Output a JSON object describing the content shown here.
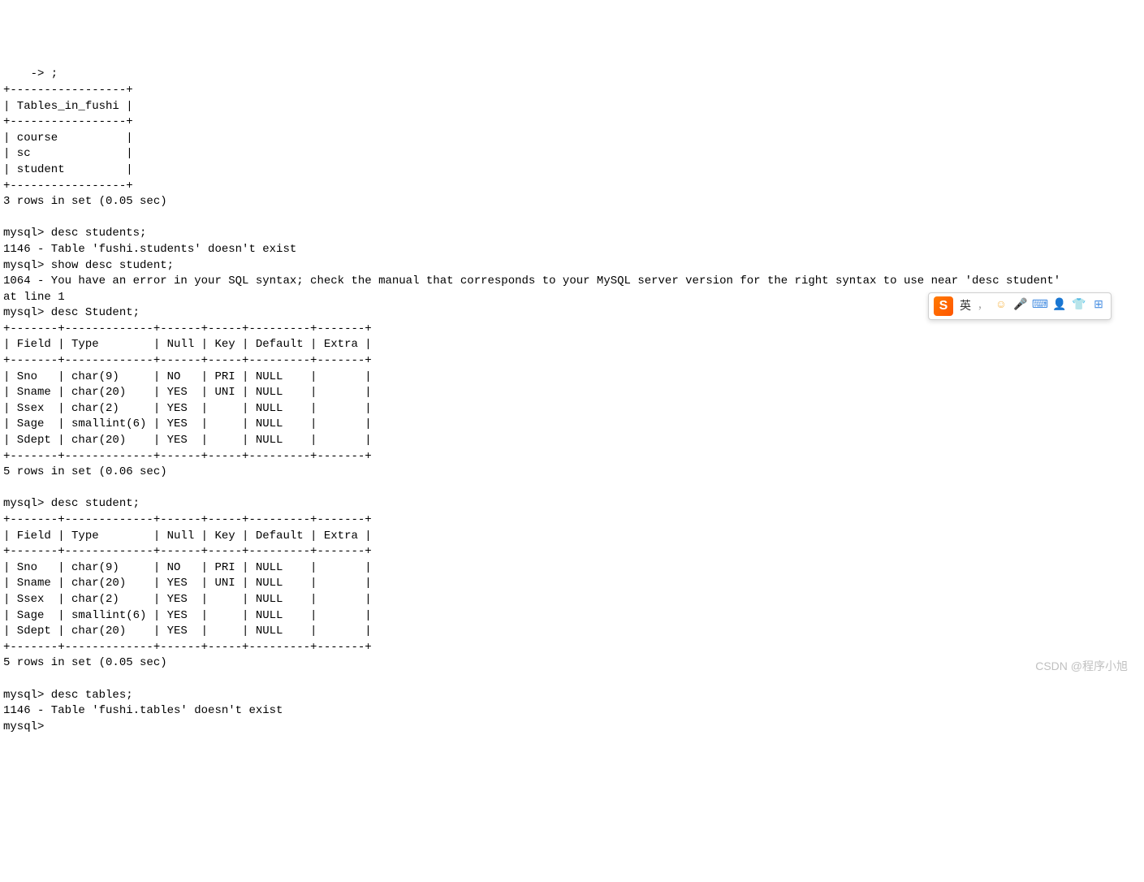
{
  "terminal": {
    "lines": [
      "    -> ;",
      "+-----------------+",
      "| Tables_in_fushi |",
      "+-----------------+",
      "| course          |",
      "| sc              |",
      "| student         |",
      "+-----------------+",
      "3 rows in set (0.05 sec)",
      "",
      "mysql> desc students;",
      "1146 - Table 'fushi.students' doesn't exist",
      "mysql> show desc student;",
      "1064 - You have an error in your SQL syntax; check the manual that corresponds to your MySQL server version for the right syntax to use near 'desc student'",
      "at line 1",
      "mysql> desc Student;",
      "+-------+-------------+------+-----+---------+-------+",
      "| Field | Type        | Null | Key | Default | Extra |",
      "+-------+-------------+------+-----+---------+-------+",
      "| Sno   | char(9)     | NO   | PRI | NULL    |       |",
      "| Sname | char(20)    | YES  | UNI | NULL    |       |",
      "| Ssex  | char(2)     | YES  |     | NULL    |       |",
      "| Sage  | smallint(6) | YES  |     | NULL    |       |",
      "| Sdept | char(20)    | YES  |     | NULL    |       |",
      "+-------+-------------+------+-----+---------+-------+",
      "5 rows in set (0.06 sec)",
      "",
      "mysql> desc student;",
      "+-------+-------------+------+-----+---------+-------+",
      "| Field | Type        | Null | Key | Default | Extra |",
      "+-------+-------------+------+-----+---------+-------+",
      "| Sno   | char(9)     | NO   | PRI | NULL    |       |",
      "| Sname | char(20)    | YES  | UNI | NULL    |       |",
      "| Ssex  | char(2)     | YES  |     | NULL    |       |",
      "| Sage  | smallint(6) | YES  |     | NULL    |       |",
      "| Sdept | char(20)    | YES  |     | NULL    |       |",
      "+-------+-------------+------+-----+---------+-------+",
      "5 rows in set (0.05 sec)",
      "",
      "mysql> desc tables;",
      "1146 - Table 'fushi.tables' doesn't exist",
      "mysql>"
    ]
  },
  "ime": {
    "logo": "S",
    "lang": "英",
    "punct": "，",
    "emoji": "☺",
    "mic": "🎤",
    "keyboard": "⌨",
    "user": "👤",
    "shirt": "👕",
    "grid": "⊞"
  },
  "watermark": "CSDN @程序小旭"
}
